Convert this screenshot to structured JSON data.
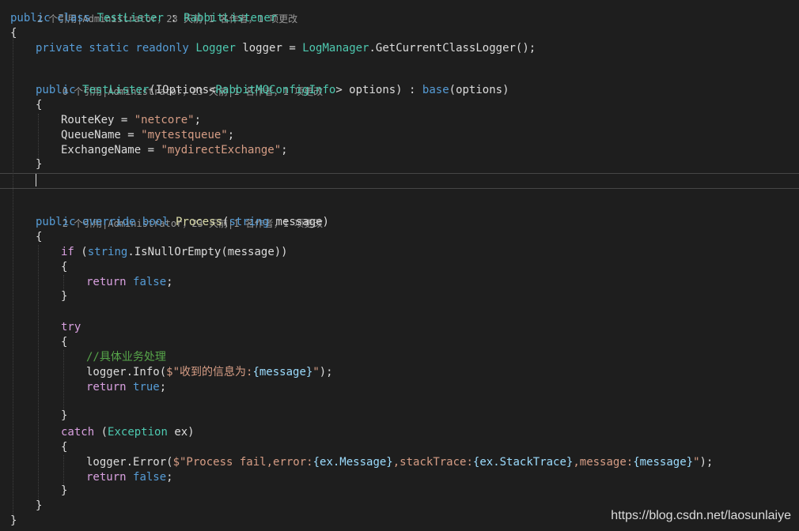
{
  "lenses": {
    "class": "2 个引用|Administrator，23 天前|1 名作者，1 项更改",
    "ctor": "0 个引用|Administrator，23 天前|1 名作者，1 项更改",
    "process": "2 个引用|Administrator，23 天前|1 名作者，1 项更改"
  },
  "code": {
    "class_decl": [
      "public",
      "class",
      "TestLister",
      ":",
      "RabbitListener"
    ],
    "brace_open": "{",
    "brace_close": "}",
    "logger_decl": [
      "private static readonly",
      "Logger",
      "logger =",
      "LogManager",
      ".GetCurrentClassLogger();"
    ],
    "ctor_decl": [
      "public",
      "TestLister",
      "(IOptions<",
      "RabbitMQConfigInfo",
      "> options) :",
      "base",
      "(options)"
    ],
    "route_key": [
      "RouteKey = ",
      "\"netcore\"",
      ";"
    ],
    "queue_name": [
      "QueueName = ",
      "\"mytestqueue\"",
      ";"
    ],
    "exchange_name": [
      "ExchangeName = ",
      "\"mydirectExchange\"",
      ";"
    ],
    "process_decl": [
      "public",
      "override",
      "bool",
      "Process",
      "(",
      "string",
      "message)"
    ],
    "if_line": [
      "if",
      "(",
      "string",
      ".IsNullOrEmpty(message))"
    ],
    "return_false": [
      "return",
      "false",
      ";"
    ],
    "try_kw": "try",
    "comment": "//具体业务处理",
    "info_line": [
      "logger.Info(",
      "$\"收到的信息为:",
      "{message}",
      "\"",
      ");"
    ],
    "return_true": [
      "return",
      "true",
      ";"
    ],
    "catch_line": [
      "catch",
      "(",
      "Exception",
      "ex)"
    ],
    "error_line": [
      "logger.Error(",
      "$\"Process fail,error:",
      "{ex.Message}",
      ",stackTrace:",
      "{ex.StackTrace}",
      ",message:",
      "{message}",
      "\"",
      ");"
    ]
  },
  "watermark": "https://blog.csdn.net/laosunlaiye"
}
